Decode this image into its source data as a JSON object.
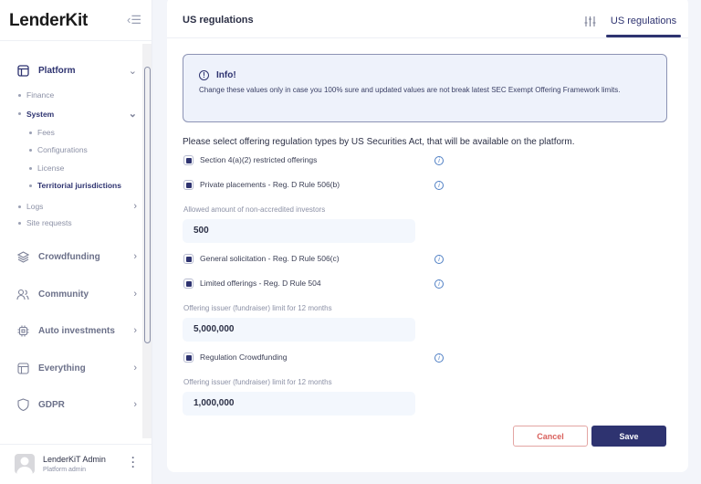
{
  "sidebar": {
    "logo": "LenderKit",
    "items": [
      {
        "label": "Platform",
        "icon": "layout-icon",
        "expanded": true
      },
      {
        "label": "Crowdfunding",
        "icon": "layers-icon"
      },
      {
        "label": "Community",
        "icon": "users-icon"
      },
      {
        "label": "Auto investments",
        "icon": "chip-icon"
      },
      {
        "label": "Everything",
        "icon": "layout-icon"
      },
      {
        "label": "GDPR",
        "icon": "shield-icon"
      }
    ],
    "platform_sub": [
      "Finance",
      "System",
      "Logs",
      "Site requests"
    ],
    "system_sub": [
      "Fees",
      "Configurations",
      "License",
      "Territorial jurisdictions"
    ],
    "user": {
      "name": "LenderKiT Admin",
      "role": "Platform admin"
    }
  },
  "header": {
    "title": "US regulations",
    "tab": "US regulations"
  },
  "info": {
    "title": "Info!",
    "text": "Change these values only in case you 100% sure and updated values are not break latest SEC Exempt Offering Framework limits."
  },
  "form": {
    "prompt": "Please select offering regulation types by US Securities Act, that will be available on the platform.",
    "options": [
      {
        "label": "Section 4(a)(2) restricted offerings",
        "checked": true
      },
      {
        "label": "Private placements - Reg. D Rule 506(b)",
        "checked": true
      },
      {
        "label": "General solicitation - Reg. D Rule 506(c)",
        "checked": true
      },
      {
        "label": "Limited offerings - Reg. D Rule 504",
        "checked": true
      },
      {
        "label": "Regulation Crowdfunding",
        "checked": true
      }
    ],
    "fields": [
      {
        "label": "Allowed amount of non-accredited investors",
        "value": "500"
      },
      {
        "label": "Offering issuer (fundraiser) limit for 12 months",
        "value": "5,000,000"
      },
      {
        "label": "Offering issuer (fundraiser) limit for 12 months",
        "value": "1,000,000"
      }
    ],
    "cancel": "Cancel",
    "save": "Save"
  },
  "colors": {
    "primary": "#2e3370",
    "cancel": "#d9605c",
    "info_bg": "#eef2fb"
  }
}
